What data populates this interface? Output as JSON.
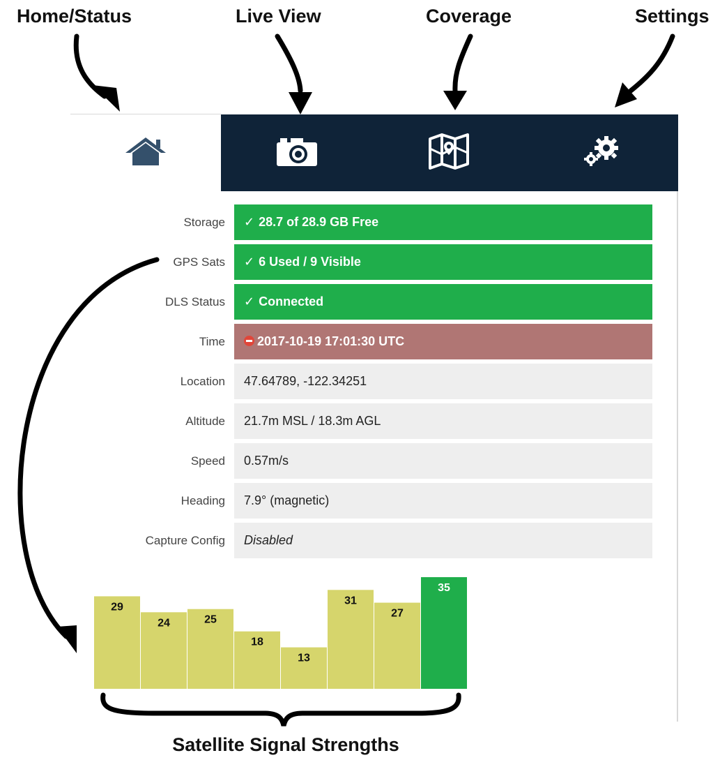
{
  "callouts": {
    "home": "Home/Status",
    "live_view": "Live View",
    "coverage": "Coverage",
    "settings": "Settings",
    "signals": "Satellite Signal Strengths"
  },
  "nav": {
    "tabs": [
      {
        "name": "home",
        "icon": "home-icon",
        "active": true
      },
      {
        "name": "live-view",
        "icon": "camera-icon",
        "active": false
      },
      {
        "name": "coverage",
        "icon": "map-icon",
        "active": false
      },
      {
        "name": "settings",
        "icon": "gears-icon",
        "active": false
      }
    ]
  },
  "status": {
    "rows": [
      {
        "label": "Storage",
        "value": "28.7 of 28.9 GB Free",
        "state": "ok",
        "icon": "check"
      },
      {
        "label": "GPS Sats",
        "value": "6 Used / 9 Visible",
        "state": "ok",
        "icon": "check"
      },
      {
        "label": "DLS Status",
        "value": "Connected",
        "state": "ok",
        "icon": "check"
      },
      {
        "label": "Time",
        "value": "2017-10-19 17:01:30 UTC",
        "state": "error",
        "icon": "no-entry-icon"
      },
      {
        "label": "Location",
        "value": "47.64789, -122.34251",
        "state": "info"
      },
      {
        "label": "Altitude",
        "value": "21.7m MSL / 18.3m AGL",
        "state": "info"
      },
      {
        "label": "Speed",
        "value": "0.57m/s",
        "state": "info"
      },
      {
        "label": "Heading",
        "value": "7.9° (magnetic)",
        "state": "info"
      },
      {
        "label": "Capture Config",
        "value": "Disabled",
        "state": "info",
        "italic": true
      }
    ]
  },
  "colors": {
    "nav_dark": "#0f2338",
    "ok": "#1fae4b",
    "error": "#b07674",
    "info": "#eeeeee",
    "bar_visible": "#d6d56c",
    "bar_used": "#1fae4b",
    "home_icon": "#34506b"
  },
  "chart_data": {
    "type": "bar",
    "categories": [
      "",
      "",
      "",
      "",
      "",
      "",
      "",
      ""
    ],
    "values": [
      29,
      24,
      25,
      18,
      13,
      31,
      27,
      35
    ],
    "highlight": [
      false,
      false,
      false,
      false,
      false,
      false,
      false,
      true
    ],
    "ylim": [
      0,
      40
    ],
    "xlabel": "",
    "ylabel": "",
    "grid": false
  }
}
